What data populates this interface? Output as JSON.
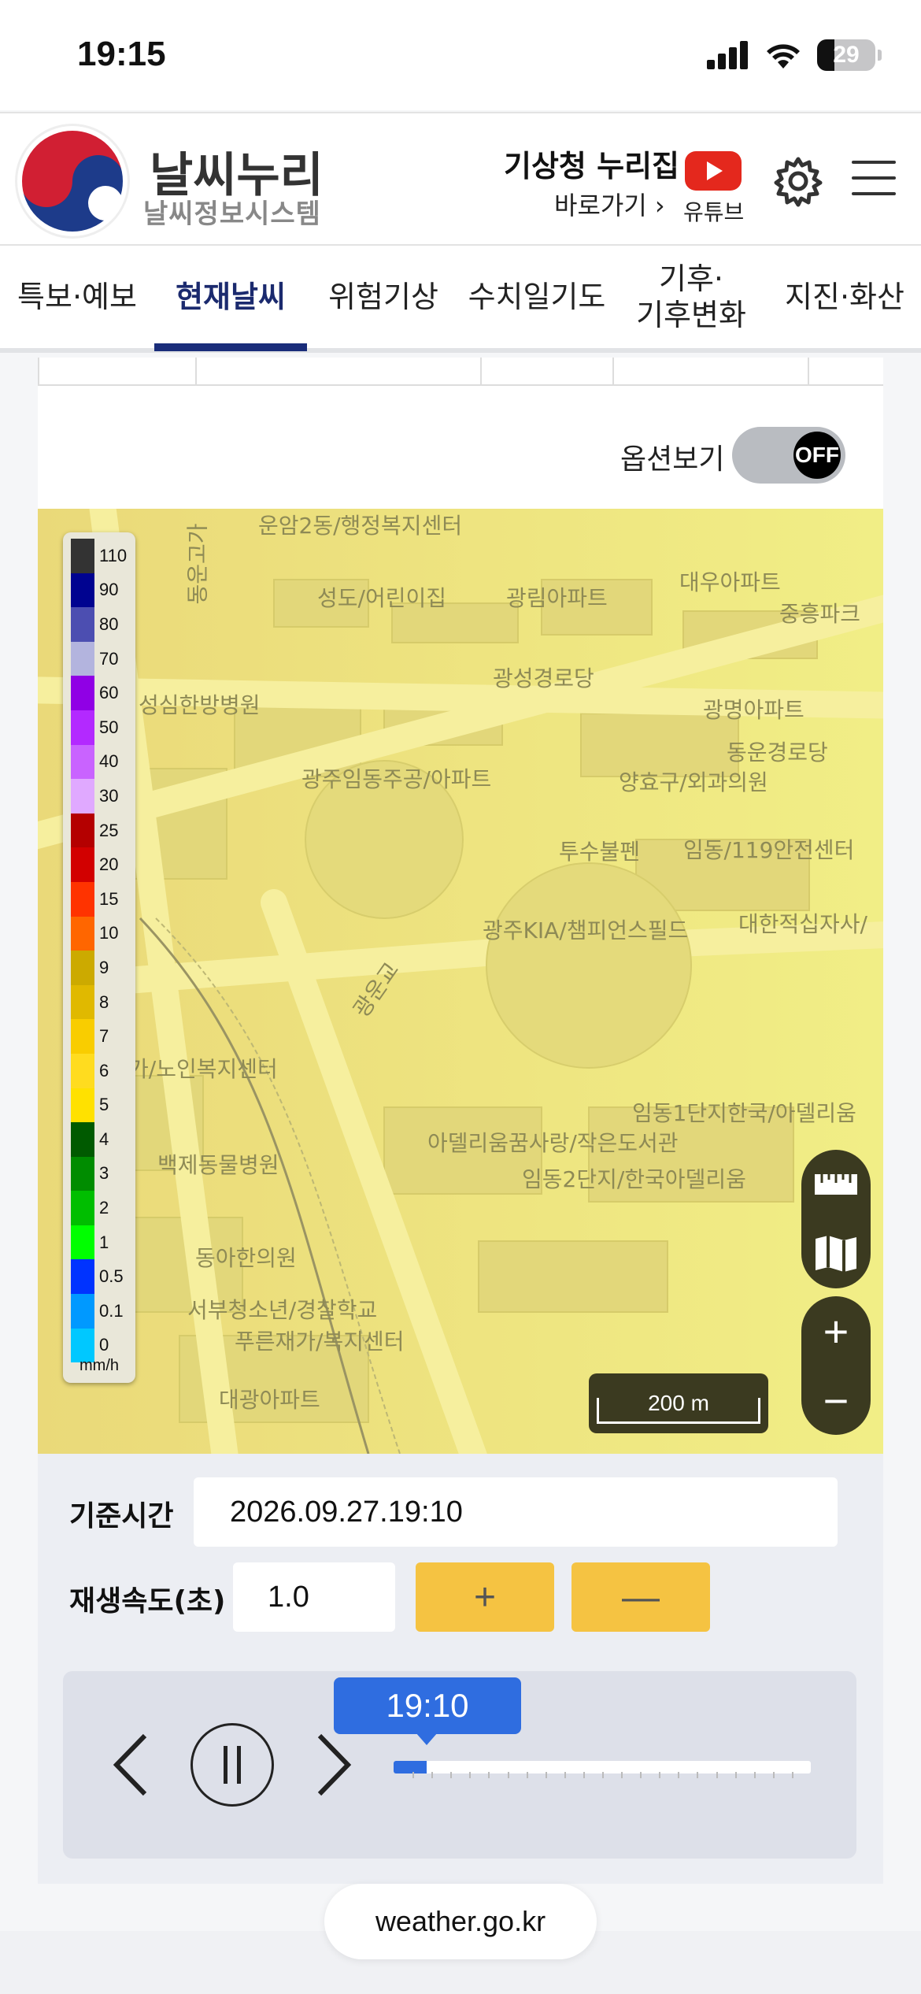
{
  "status_bar": {
    "time": "19:15",
    "battery": "29"
  },
  "header": {
    "brand_title": "날씨누리",
    "brand_subtitle": "날씨정보시스템",
    "nurijip_title": "기상청 누리집",
    "nurijip_link": "바로가기 ›",
    "youtube_label": "유튜브"
  },
  "nav": {
    "items": [
      {
        "label": "특보·예보"
      },
      {
        "label": "현재날씨"
      },
      {
        "label": "위험기상"
      },
      {
        "label": "수치일기도"
      },
      {
        "label": "기후·\n기후변화"
      },
      {
        "label": "지진·화산"
      }
    ],
    "active_index": 1
  },
  "options": {
    "label": "옵션보기",
    "toggle_state": "OFF"
  },
  "map": {
    "labels": [
      "운암2동/행정복지센터",
      "성도/어린이집",
      "광림아파트",
      "대우아파트",
      "중흥파크",
      "광성경로당",
      "성심한방병원",
      "광명아파트",
      "동운경로당",
      "광주임동주공/아파트",
      "양효구/외과의원",
      "투수불펜",
      "임동/119안전센터",
      "광주KIA/챔피언스필드",
      "대한적십자사/",
      "가/노인복지센터",
      "임동1단지한국/아델리움",
      "아델리움꿈사랑/작은도서관",
      "임동2단지/한국아델리움",
      "백제동물병원",
      "동아한의원",
      "서부청소년/경찰학교",
      "푸른재가/복지센터",
      "대광아파트",
      "광운교",
      "동운고가"
    ],
    "legend": {
      "unit": "mm/h",
      "entries": [
        {
          "value": "110",
          "color": "#333333"
        },
        {
          "value": "90",
          "color": "#000390"
        },
        {
          "value": "80",
          "color": "#4c4eb1"
        },
        {
          "value": "70",
          "color": "#b3b4de"
        },
        {
          "value": "60",
          "color": "#9000e5"
        },
        {
          "value": "50",
          "color": "#b329ff"
        },
        {
          "value": "40",
          "color": "#c963ff"
        },
        {
          "value": "30",
          "color": "#e0a9ff"
        },
        {
          "value": "25",
          "color": "#b40000"
        },
        {
          "value": "20",
          "color": "#d20000"
        },
        {
          "value": "15",
          "color": "#ff3300"
        },
        {
          "value": "10",
          "color": "#ff6600"
        },
        {
          "value": "9",
          "color": "#ccaa00"
        },
        {
          "value": "8",
          "color": "#e0b900"
        },
        {
          "value": "7",
          "color": "#f9cd00"
        },
        {
          "value": "6",
          "color": "#ffdc1f"
        },
        {
          "value": "5",
          "color": "#ffe100"
        },
        {
          "value": "4",
          "color": "#005a00"
        },
        {
          "value": "3",
          "color": "#008c00"
        },
        {
          "value": "2",
          "color": "#00be00"
        },
        {
          "value": "1",
          "color": "#00ff00"
        },
        {
          "value": "0.5",
          "color": "#0033ff"
        },
        {
          "value": "0.1",
          "color": "#0099ff"
        },
        {
          "value": "0",
          "color": "#00c8ff"
        }
      ]
    },
    "scale_label": "200 m"
  },
  "controls": {
    "base_time_label": "기준시간",
    "base_time_value": "2026.09.27.19:10",
    "speed_label": "재생속도(초)",
    "speed_value": "1.0",
    "plus_label": "+",
    "minus_label": "—",
    "tooltip_time": "19:10",
    "progress": 0.08
  },
  "footer": {
    "url": "weather.go.kr"
  },
  "colors": {
    "accent_blue": "#2f6de0",
    "nav_active": "#1a2d7a",
    "speed_btn": "#f5c342",
    "map_tool": "#3b3a20"
  }
}
